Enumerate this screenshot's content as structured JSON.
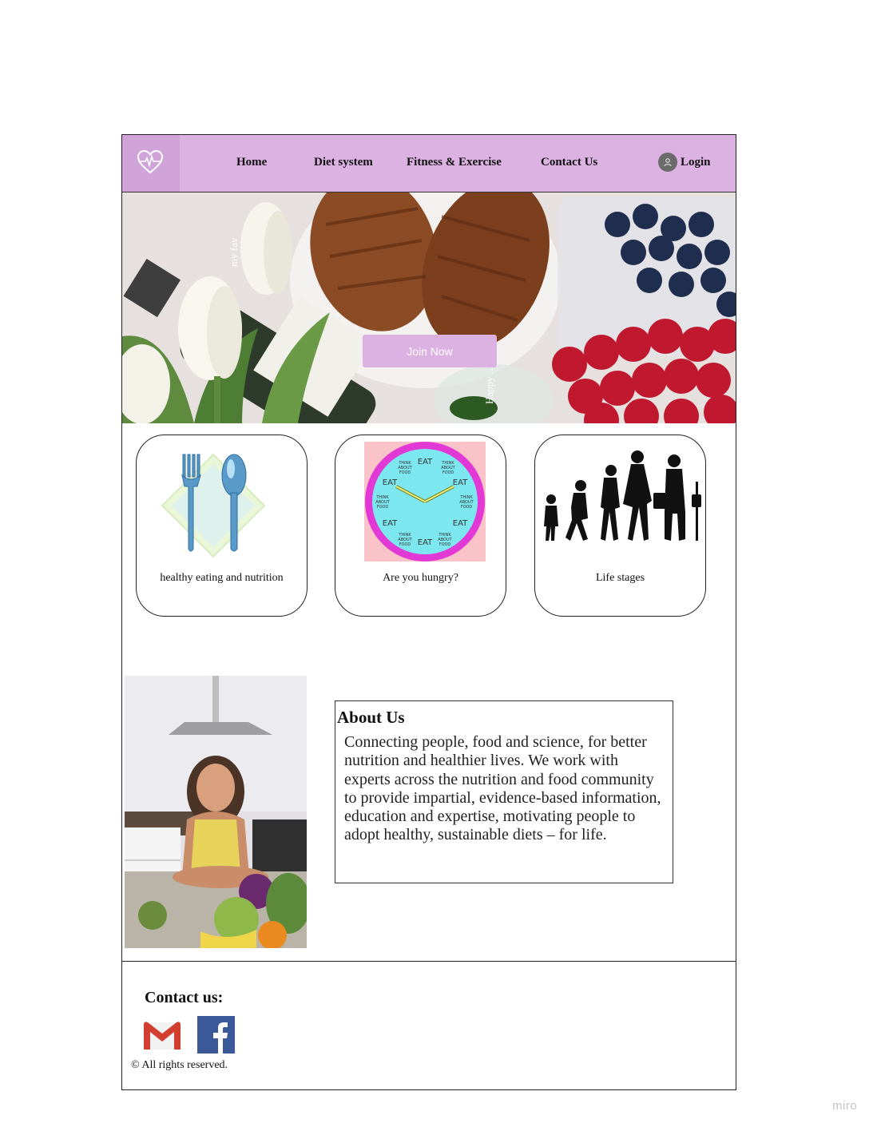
{
  "nav": {
    "items": [
      {
        "label": "Home"
      },
      {
        "label": "Diet system"
      },
      {
        "label": "Fitness & Exercise"
      },
      {
        "label": "Contact Us"
      }
    ],
    "login_label": "Login"
  },
  "hero": {
    "join_label": "Join Now",
    "overlay_text_1": "my fav",
    "overlay_text_2": "Happy ... s Day!"
  },
  "cards": [
    {
      "caption": "healthy eating and nutrition",
      "icon": "fork-spoon-icon"
    },
    {
      "caption": "Are you hungry?",
      "icon": "eat-clock-icon"
    },
    {
      "caption": "Life stages",
      "icon": "life-stages-icon"
    }
  ],
  "clock": {
    "eat": "EAT",
    "think": "THINK ABOUT FOOD"
  },
  "about": {
    "title": "About Us",
    "body": "Connecting people, food and science, for better nutrition and healthier lives. We work with experts across the nutrition and food community to provide impartial, evidence-based information, education and expertise, motivating people to adopt healthy, sustainable diets – for life."
  },
  "footer": {
    "contact_title": "Contact us:",
    "copyright": "© All rights reserved.",
    "icons": [
      "gmail-icon",
      "facebook-icon"
    ]
  },
  "watermark": "miro",
  "colors": {
    "nav_bg": "#dcb2e3",
    "logo_bg": "#d0a4d9",
    "button_bg": "#dcb2e3"
  }
}
